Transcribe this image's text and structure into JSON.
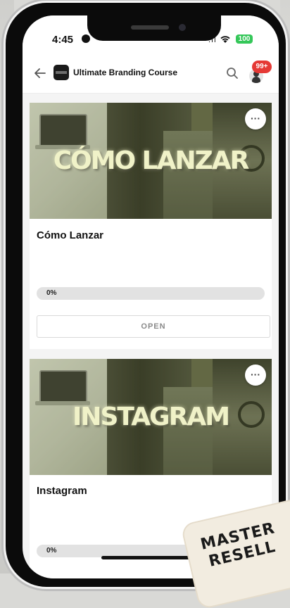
{
  "status_bar": {
    "time": "4:45",
    "battery": "100"
  },
  "header": {
    "title": "Ultimate Branding Course",
    "notification_count": "99+"
  },
  "courses": [
    {
      "banner_text": "CÓMO LANZAR",
      "title": "Cómo Lanzar",
      "progress": 0,
      "progress_label": "0%",
      "button_label": "OPEN",
      "menu": "···"
    },
    {
      "banner_text": "INSTAGRAM",
      "title": "Instagram",
      "progress": 0,
      "progress_label": "0%",
      "menu": "···"
    }
  ],
  "stamp": {
    "line1": "MASTER",
    "line2": "RESELL"
  },
  "colors": {
    "badge": "#e53935",
    "battery": "#35c759",
    "progress_track": "#e2e2e2"
  }
}
